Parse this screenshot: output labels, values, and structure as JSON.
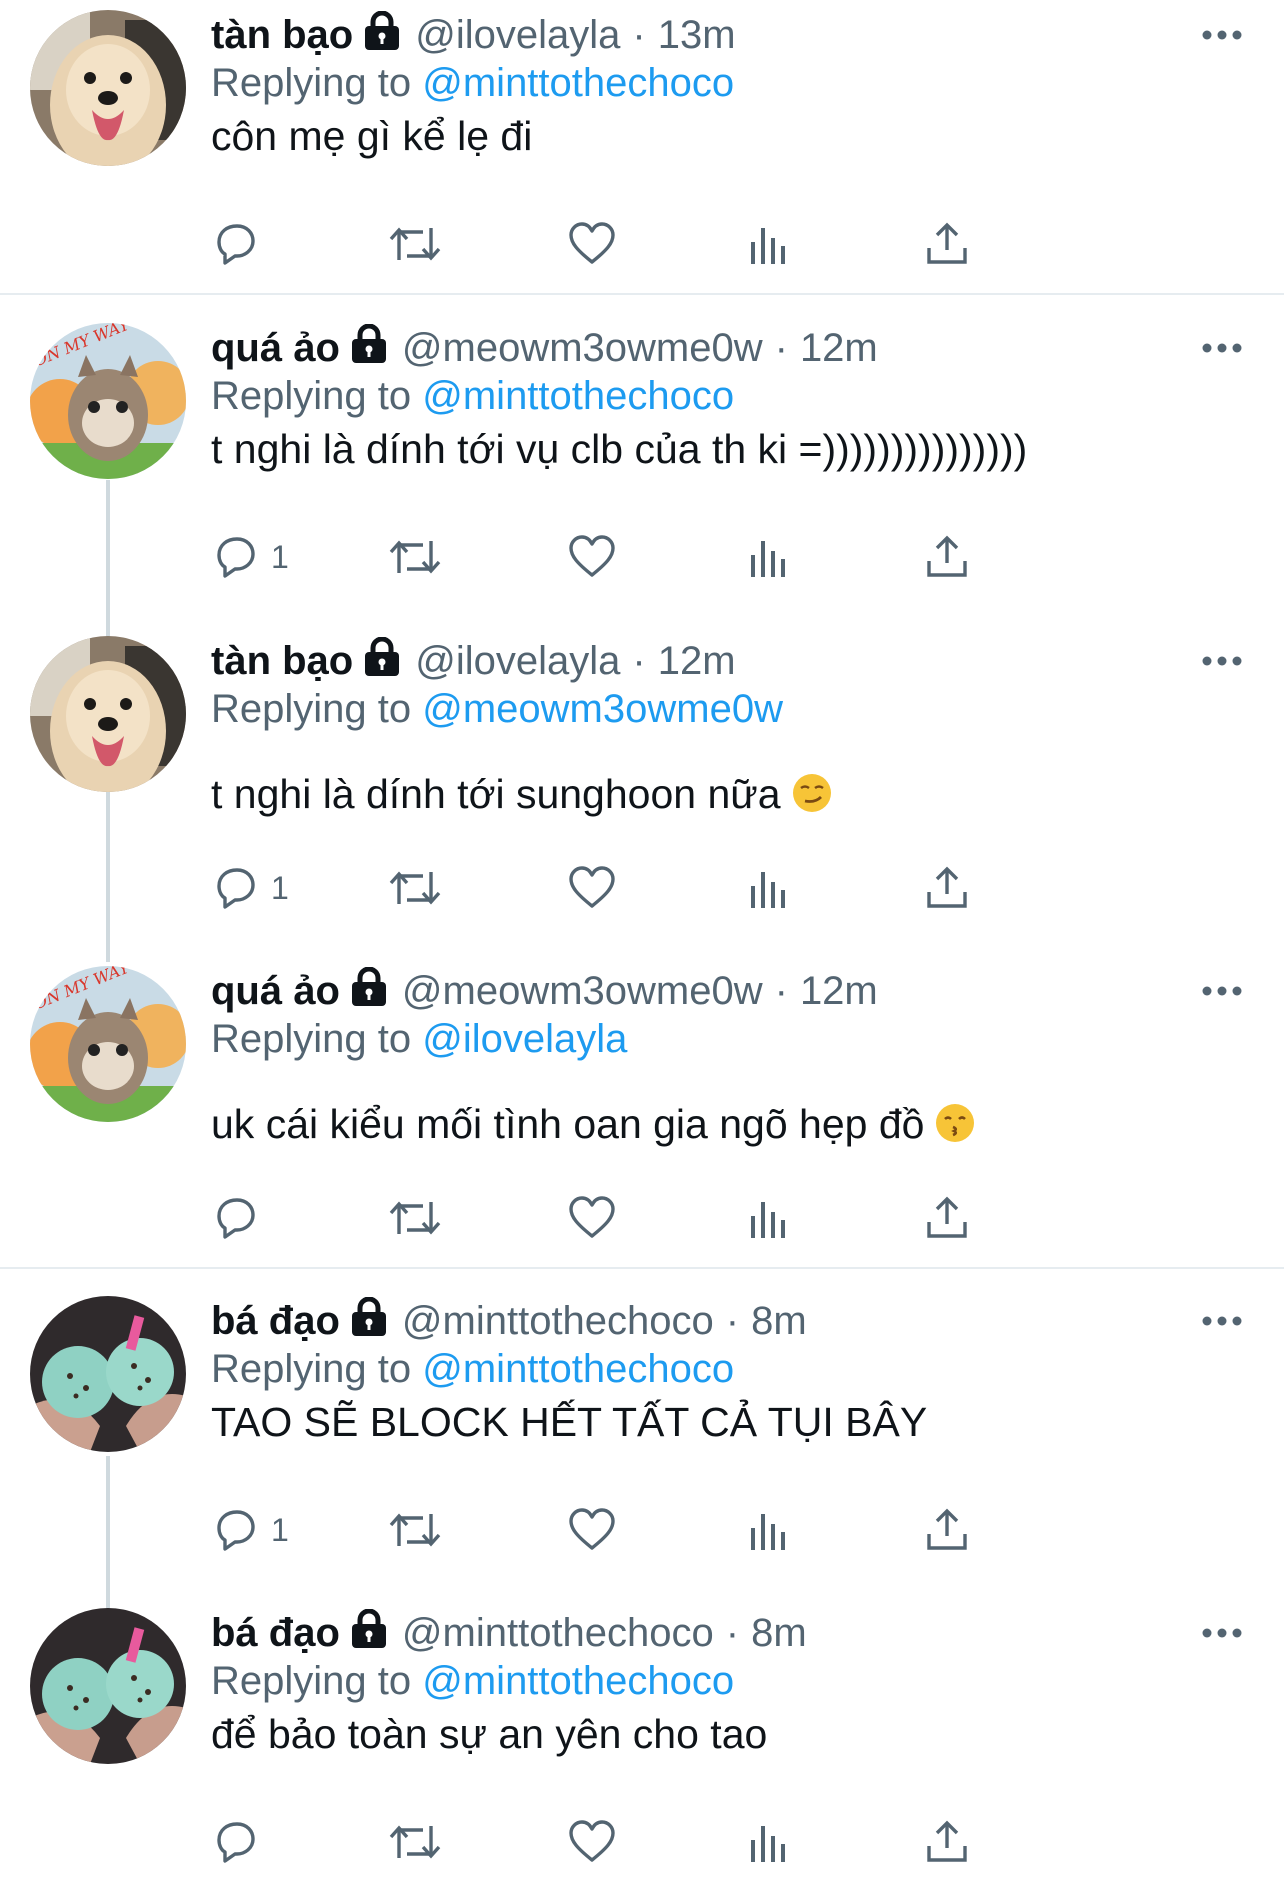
{
  "tweets": [
    {
      "name": "tàn bạo",
      "handle": "@ilovelayla",
      "time": "13m",
      "replying_prefix": "Replying to",
      "replying_to": "@minttothechoco",
      "text": "côn mẹ gì kể lẹ đi",
      "reply_count": "",
      "avatar": "dog-avatar"
    },
    {
      "name": "quá ảo",
      "handle": "@meowm3owme0w",
      "time": "12m",
      "replying_prefix": "Replying to",
      "replying_to": "@minttothechoco",
      "text": "t nghi là dính tới vụ clb của th ki =)))))))))))))))",
      "reply_count": "1",
      "avatar": "cat-avatar",
      "avatar_text": "ON MY WAY"
    },
    {
      "name": "tàn bạo",
      "handle": "@ilovelayla",
      "time": "12m",
      "replying_prefix": "Replying to",
      "replying_to": "@meowm3owme0w",
      "text": "t nghi là dính tới sunghoon nữa",
      "emoji": "smirk",
      "reply_count": "1",
      "avatar": "dog-avatar"
    },
    {
      "name": "quá ảo",
      "handle": "@meowm3owme0w",
      "time": "12m",
      "replying_prefix": "Replying to",
      "replying_to": "@ilovelayla",
      "text": "uk cái kiểu mối tình oan gia ngõ hẹp đồ",
      "emoji": "kissing",
      "reply_count": "",
      "avatar": "cat-avatar",
      "avatar_text": "ON MY WAY"
    },
    {
      "name": "bá đạo",
      "handle": "@minttothechoco",
      "time": "8m",
      "replying_prefix": "Replying to",
      "replying_to": "@minttothechoco",
      "text": "TAO SẼ BLOCK HẾT TẤT CẢ TỤI BÂY",
      "reply_count": "1",
      "avatar": "icecream-avatar"
    },
    {
      "name": "bá đạo",
      "handle": "@minttothechoco",
      "time": "8m",
      "replying_prefix": "Replying to",
      "replying_to": "@minttothechoco",
      "text": "để bảo toàn sự an yên cho tao",
      "reply_count": "",
      "avatar": "icecream-avatar"
    }
  ],
  "separator_symbol": "·",
  "colors": {
    "text": "#0f1419",
    "secondary": "#536471",
    "link": "#1d9bf0",
    "divider": "#e6ecf0",
    "thread_line": "#cfd9de"
  }
}
